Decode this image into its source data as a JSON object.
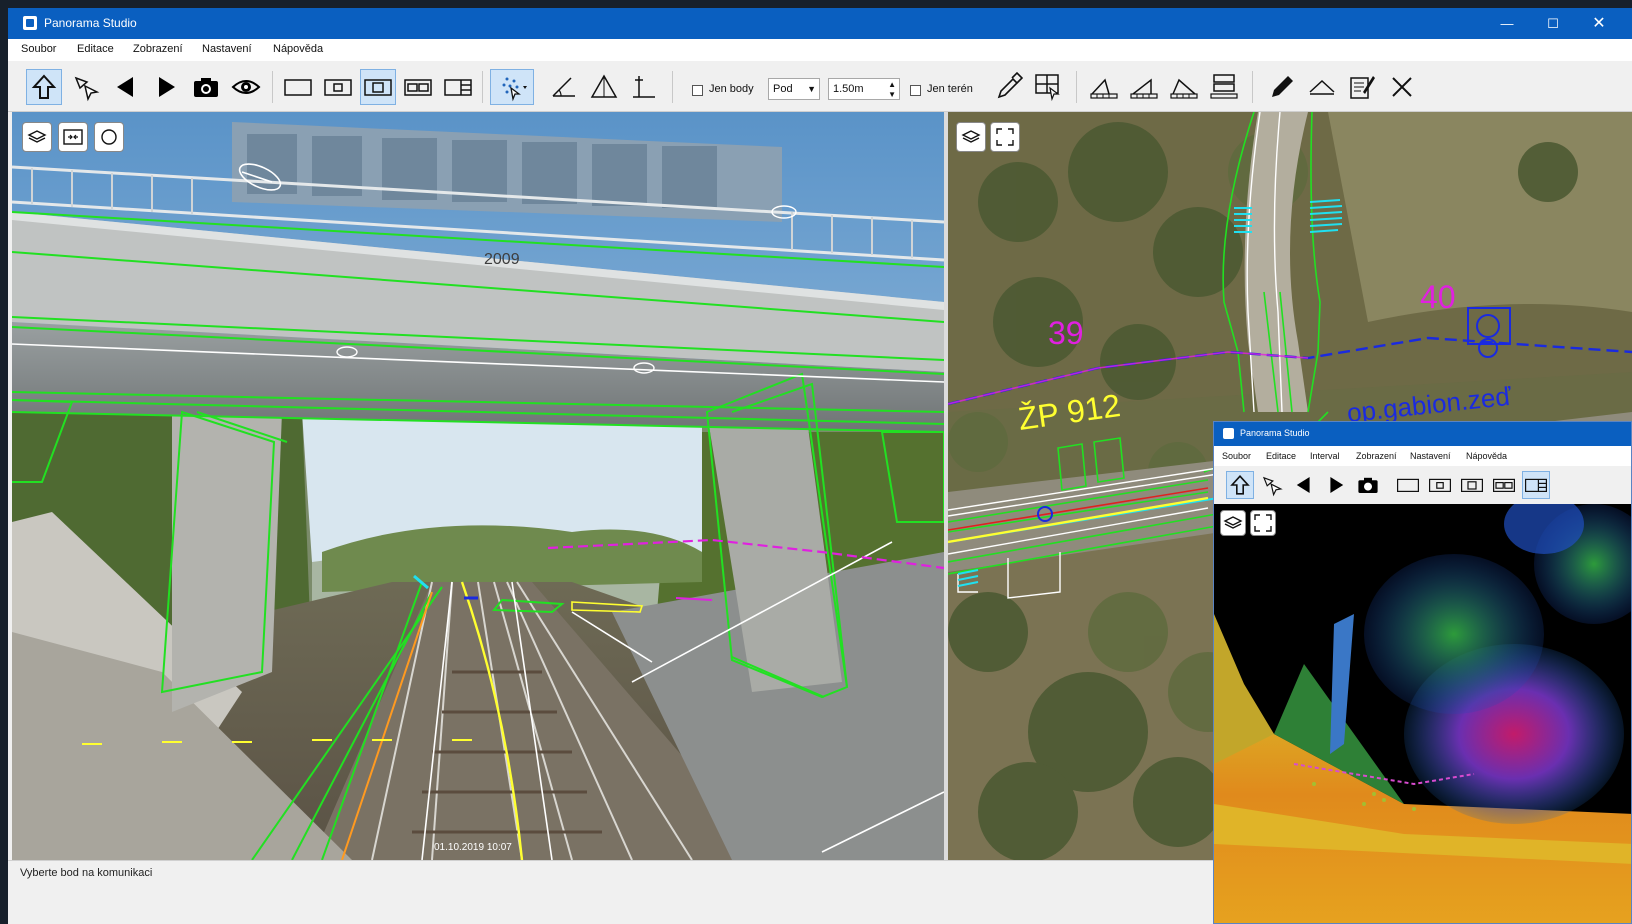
{
  "window": {
    "title": "Panorama Studio"
  },
  "menu": [
    "Soubor",
    "Editace",
    "Zobrazení",
    "Nastavení",
    "Nápověda"
  ],
  "toolbar": {
    "points_only_label": "Jen body",
    "mode_select": "Pod",
    "distance_value": "1.50m",
    "terrain_only_label": "Jen terén"
  },
  "panorama": {
    "bridge_label": "2009",
    "timestamp": "01.10.2019 10:07"
  },
  "map": {
    "label_39": "39",
    "label_40": "40",
    "label_zp": "ŽP 912",
    "label_gabion": "op.gabion.zeď"
  },
  "inset": {
    "title": "Panorama Studio",
    "menu": [
      "Soubor",
      "Editace",
      "Interval",
      "Zobrazení",
      "Nastavení",
      "Nápověda"
    ]
  },
  "status": {
    "text": "Vyberte bod na komunikaci"
  },
  "colors": {
    "titlebar": "#0a5fc0",
    "overlay_green": "#22e022",
    "overlay_magenta": "#e020e0",
    "overlay_blue": "#1a2ae0",
    "overlay_yellow": "#ffff30",
    "overlay_cyan": "#20e0f0"
  }
}
